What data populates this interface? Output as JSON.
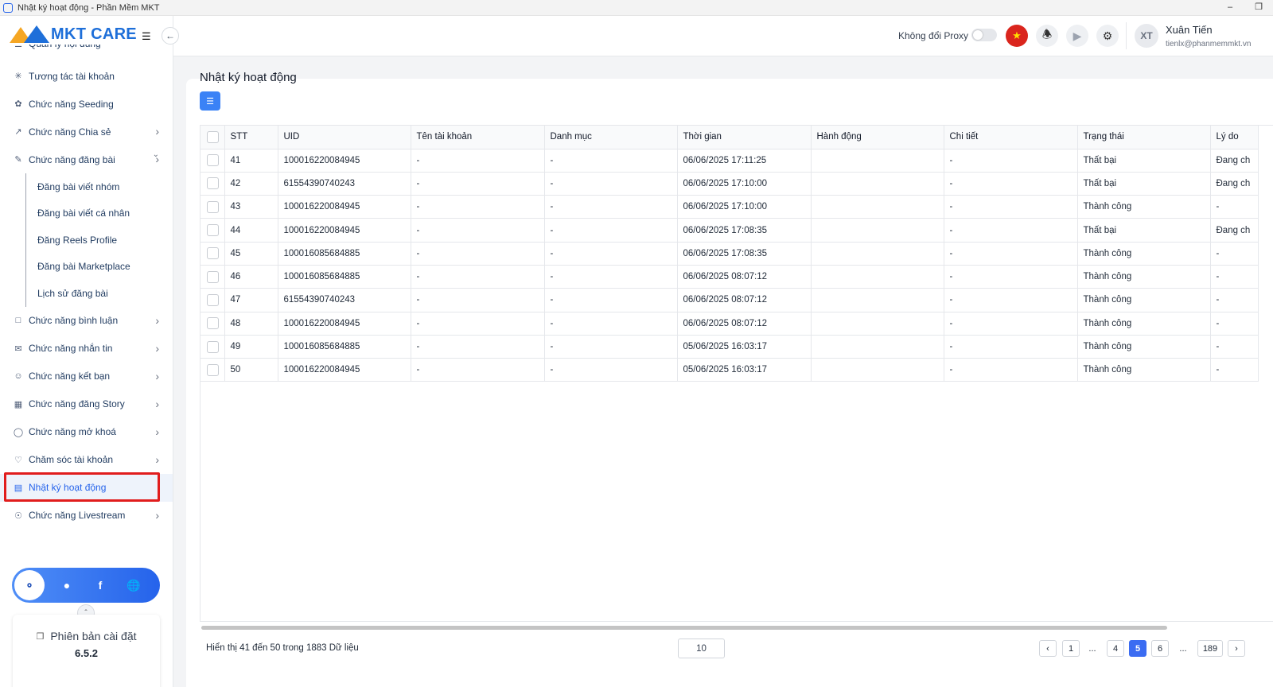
{
  "window": {
    "title": "Nhật ký hoạt động - Phần Mềm MKT",
    "minimize": "–",
    "restore": "❐"
  },
  "brand": {
    "name": "MKT CARE"
  },
  "sidebar": {
    "partial_item": "Quản lý nội dung",
    "items": [
      {
        "label": "Tương tác tài khoản",
        "icon": "interaction-icon",
        "chevron": false
      },
      {
        "label": "Chức năng Seeding",
        "icon": "seeding-icon",
        "chevron": false
      },
      {
        "label": "Chức năng Chia sẻ",
        "icon": "share-icon",
        "chevron": true
      },
      {
        "label": "Chức năng đăng bài",
        "icon": "post-icon",
        "chevron": true,
        "expanded": true
      }
    ],
    "sub_items": [
      "Đăng bài viết nhóm",
      "Đăng bài viết cá nhân",
      "Đăng Reels Profile",
      "Đăng bài Marketplace",
      "Lịch sử đăng bài"
    ],
    "items_after": [
      {
        "label": "Chức năng bình luận",
        "icon": "comment-icon",
        "chevron": true
      },
      {
        "label": "Chức năng nhắn tin",
        "icon": "message-icon",
        "chevron": true
      },
      {
        "label": "Chức năng kết bạn",
        "icon": "add-friend-icon",
        "chevron": true
      },
      {
        "label": "Chức năng đăng Story",
        "icon": "story-icon",
        "chevron": true
      },
      {
        "label": "Chức năng mở khoá",
        "icon": "unlock-icon",
        "chevron": true
      },
      {
        "label": "Chăm sóc tài khoản",
        "icon": "care-icon",
        "chevron": true
      },
      {
        "label": "Nhật ký hoạt động",
        "icon": "log-icon",
        "chevron": false,
        "active": true
      },
      {
        "label": "Chức năng Livestream",
        "icon": "livestream-icon",
        "chevron": true
      }
    ],
    "version_label": "Phiên bản cài đặt",
    "version": "6.5.2"
  },
  "header": {
    "proxy_label": "Không đổi Proxy",
    "proxy_enabled": false,
    "user_initials": "XT",
    "user_name": "Xuân Tiến",
    "user_email": "tienlx@phanmemmkt.vn"
  },
  "main": {
    "title": "Nhật ký hoạt động",
    "columns": [
      "STT",
      "UID",
      "Tên tài khoản",
      "Danh mục",
      "Thời gian",
      "Hành động",
      "Chi tiết",
      "Trạng thái",
      "Lý do"
    ],
    "rows": [
      [
        "41",
        "100016220084945",
        "-",
        "-",
        "06/06/2025 17:11:25",
        "",
        "-",
        "Thất bại",
        "Đang ch"
      ],
      [
        "42",
        "61554390740243",
        "-",
        "-",
        "06/06/2025 17:10:00",
        "",
        "-",
        "Thất bại",
        "Đang ch"
      ],
      [
        "43",
        "100016220084945",
        "-",
        "-",
        "06/06/2025 17:10:00",
        "",
        "-",
        "Thành công",
        "-"
      ],
      [
        "44",
        "100016220084945",
        "-",
        "-",
        "06/06/2025 17:08:35",
        "",
        "-",
        "Thất bại",
        "Đang ch"
      ],
      [
        "45",
        "100016085684885",
        "-",
        "-",
        "06/06/2025 17:08:35",
        "",
        "-",
        "Thành công",
        "-"
      ],
      [
        "46",
        "100016085684885",
        "-",
        "-",
        "06/06/2025 08:07:12",
        "",
        "-",
        "Thành công",
        "-"
      ],
      [
        "47",
        "61554390740243",
        "-",
        "-",
        "06/06/2025 08:07:12",
        "",
        "-",
        "Thành công",
        "-"
      ],
      [
        "48",
        "100016220084945",
        "-",
        "-",
        "06/06/2025 08:07:12",
        "",
        "-",
        "Thành công",
        "-"
      ],
      [
        "49",
        "100016085684885",
        "-",
        "-",
        "05/06/2025 16:03:17",
        "",
        "-",
        "Thành công",
        "-"
      ],
      [
        "50",
        "100016220084945",
        "-",
        "-",
        "05/06/2025 16:03:17",
        "",
        "-",
        "Thành công",
        "-"
      ]
    ],
    "footer_info": "Hiển thị 41 đến 50 trong 1883 Dữ liệu",
    "page_size": "10",
    "pagination": {
      "prev": "‹",
      "next": "›",
      "pages": [
        "1",
        "...",
        "4",
        "5",
        "6",
        "...",
        "189"
      ],
      "current": "5"
    }
  }
}
